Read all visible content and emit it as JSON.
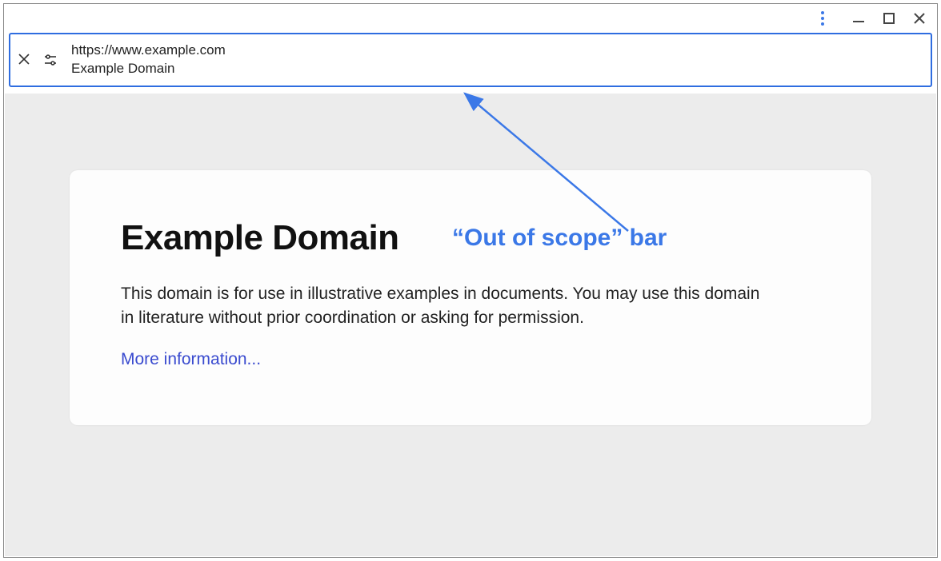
{
  "titlebar": {
    "more_icon": "more-vertical",
    "minimize_icon": "minimize",
    "maximize_icon": "maximize",
    "close_icon": "close"
  },
  "addr_bar": {
    "close_icon": "close",
    "tune_icon": "tune",
    "url": "https://www.example.com",
    "title": "Example Domain"
  },
  "page": {
    "heading": "Example Domain",
    "body": "This domain is for use in illustrative examples in documents. You may use this domain in literature without prior coordination or asking for permission.",
    "link_text": "More information..."
  },
  "annotation": {
    "label": "“Out of scope” bar",
    "color": "#3b78e7"
  }
}
